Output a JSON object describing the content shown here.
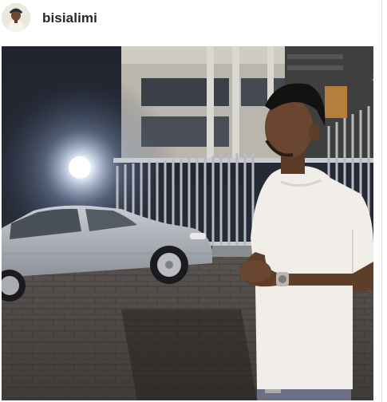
{
  "post": {
    "username": "bisialimi",
    "edge_mark": "2"
  },
  "icons": {
    "avatar": "profile-avatar",
    "photo": "post-photo"
  }
}
